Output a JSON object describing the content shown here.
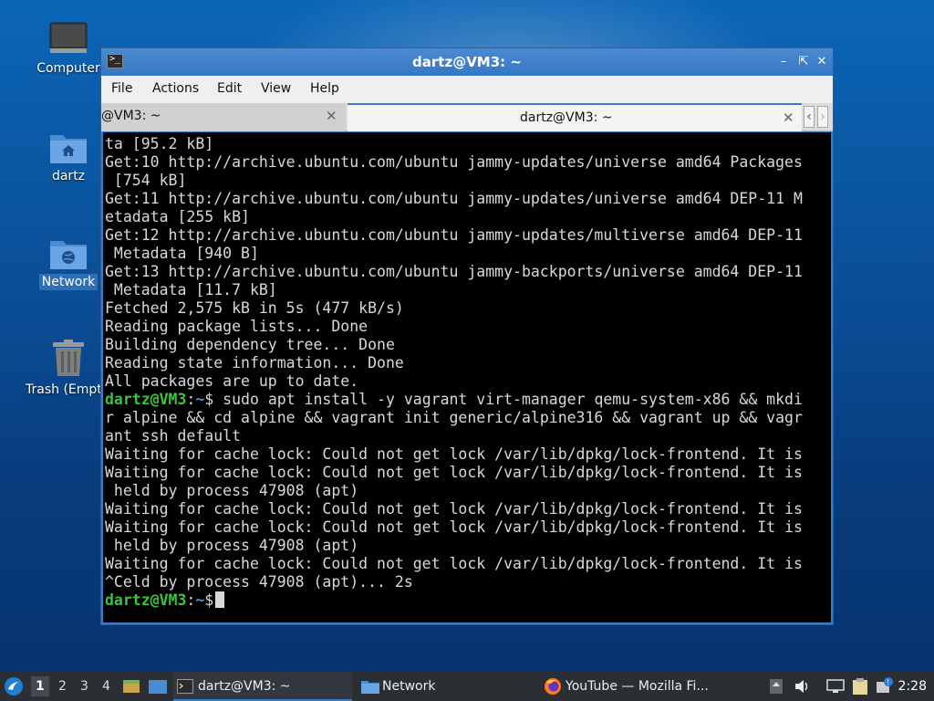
{
  "desktop": {
    "icons": [
      {
        "label": "Computer"
      },
      {
        "label": "dartz"
      },
      {
        "label": "Network"
      },
      {
        "label": "Trash (Empty)"
      }
    ]
  },
  "window": {
    "title": "dartz@VM3: ~",
    "menu": [
      "File",
      "Actions",
      "Edit",
      "View",
      "Help"
    ],
    "tabs": [
      {
        "label": "@VM3: ~",
        "active": false
      },
      {
        "label": "dartz@VM3: ~",
        "active": true
      }
    ],
    "terminal": {
      "lines": [
        "ta [95.2 kB]",
        "Get:10 http://archive.ubuntu.com/ubuntu jammy-updates/universe amd64 Packages",
        " [754 kB]",
        "Get:11 http://archive.ubuntu.com/ubuntu jammy-updates/universe amd64 DEP-11 M",
        "etadata [255 kB]",
        "Get:12 http://archive.ubuntu.com/ubuntu jammy-updates/multiverse amd64 DEP-11",
        " Metadata [940 B]",
        "Get:13 http://archive.ubuntu.com/ubuntu jammy-backports/universe amd64 DEP-11",
        " Metadata [11.7 kB]",
        "Fetched 2,575 kB in 5s (477 kB/s)",
        "Reading package lists... Done",
        "Building dependency tree... Done",
        "Reading state information... Done",
        "All packages are up to date."
      ],
      "prompt_user": "dartz@VM3",
      "prompt_sep": ":",
      "prompt_path": "~",
      "prompt_symbol": "$",
      "command": " sudo apt install -y vagrant virt-manager qemu-system-x86 && mkdi",
      "command_cont": [
        "r alpine && cd alpine && vagrant init generic/alpine316 && vagrant up && vagr",
        "ant ssh default"
      ],
      "output": [
        "Waiting for cache lock: Could not get lock /var/lib/dpkg/lock-frontend. It is",
        "Waiting for cache lock: Could not get lock /var/lib/dpkg/lock-frontend. It is",
        " held by process 47908 (apt)",
        "Waiting for cache lock: Could not get lock /var/lib/dpkg/lock-frontend. It is",
        "Waiting for cache lock: Could not get lock /var/lib/dpkg/lock-frontend. It is",
        " held by process 47908 (apt)",
        "Waiting for cache lock: Could not get lock /var/lib/dpkg/lock-frontend. It is",
        "^Celd by process 47908 (apt)... 2s"
      ]
    }
  },
  "taskbar": {
    "workspaces": [
      "1",
      "2",
      "3",
      "4"
    ],
    "tasks": [
      {
        "label": "dartz@VM3: ~",
        "icon": "terminal-icon"
      },
      {
        "label": "Network",
        "icon": "folder-icon"
      },
      {
        "label": "YouTube — Mozilla Fi...",
        "icon": "firefox-icon"
      }
    ],
    "clock": "2:28"
  },
  "colors": {
    "accent": "#3a7bc8",
    "prompt_user": "#3ec23e",
    "prompt_path": "#4e8fe6"
  }
}
